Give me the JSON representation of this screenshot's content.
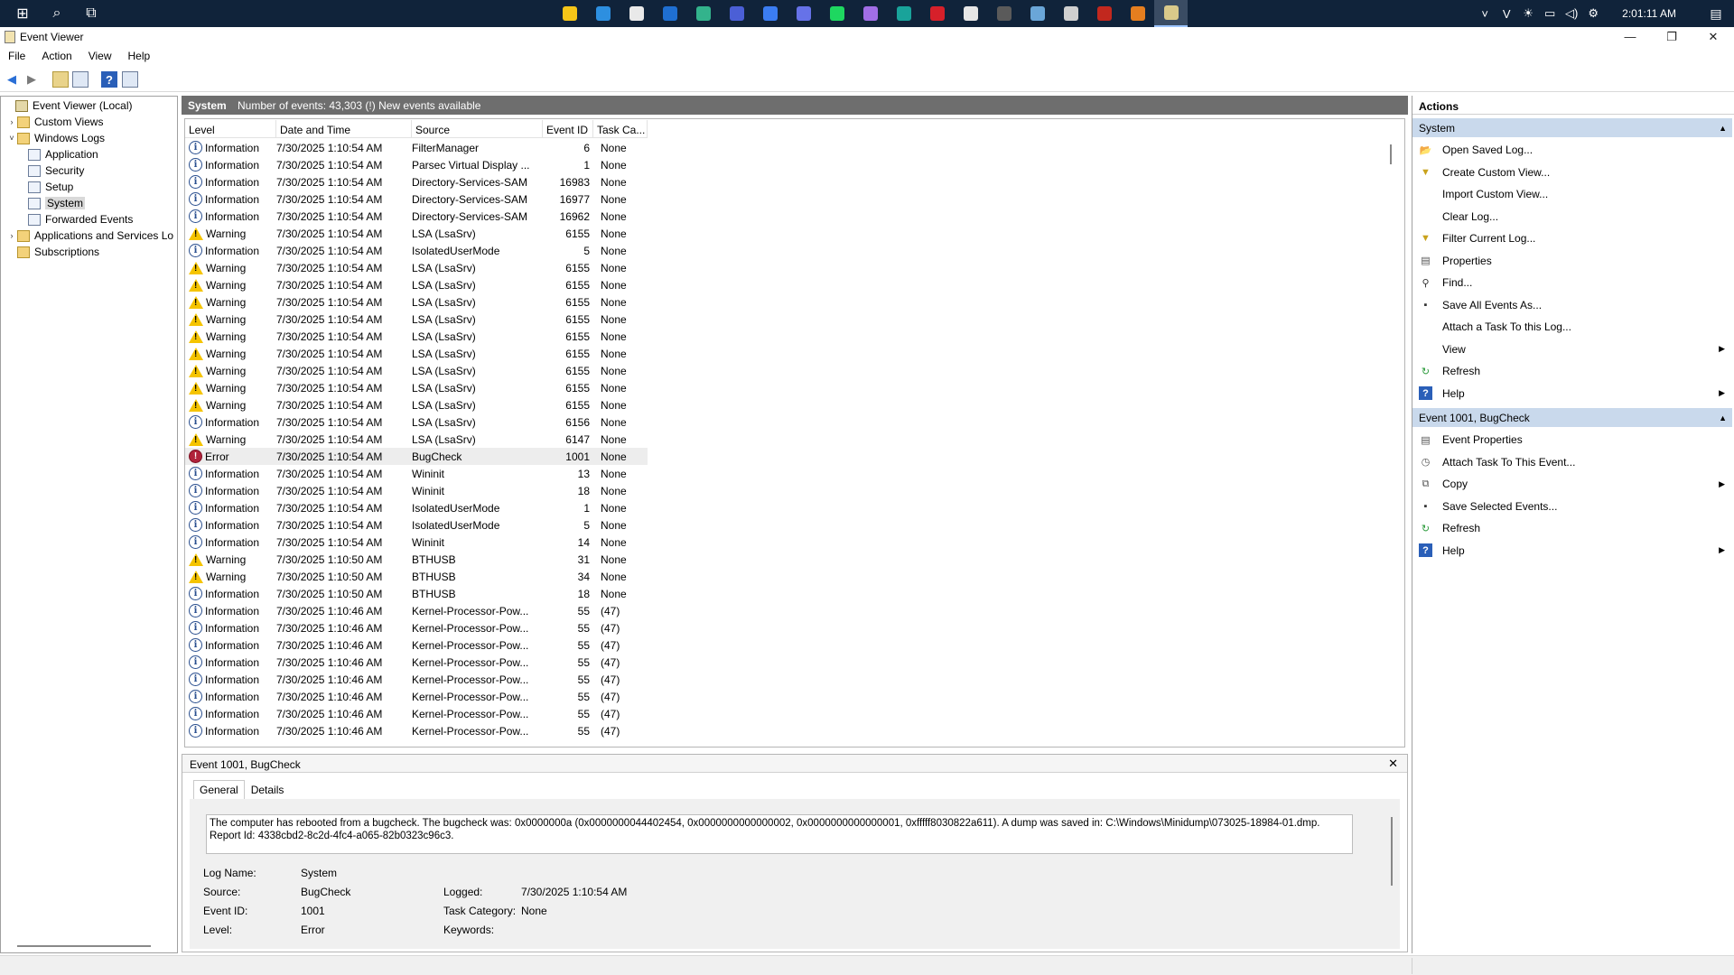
{
  "taskbar": {
    "apps": [
      {
        "name": "file-explorer-icon",
        "color": "#f5c518"
      },
      {
        "name": "vscode-icon",
        "color": "#2d8fe0"
      },
      {
        "name": "store-icon",
        "color": "#e9e9e9"
      },
      {
        "name": "remote-desktop-icon",
        "color": "#1f6fd1"
      },
      {
        "name": "edge-icon",
        "color": "#33b38c"
      },
      {
        "name": "teams-icon",
        "color": "#4b5fd6"
      },
      {
        "name": "messenger-icon",
        "color": "#3b7df2"
      },
      {
        "name": "discord-icon",
        "color": "#6672e8"
      },
      {
        "name": "spotify-icon",
        "color": "#1ed760"
      },
      {
        "name": "github-icon",
        "color": "#a16ee6"
      },
      {
        "name": "arduino-icon",
        "color": "#19a39a"
      },
      {
        "name": "amd-icon",
        "color": "#d6202a"
      },
      {
        "name": "media-icon",
        "color": "#e6e6e6"
      },
      {
        "name": "obs-icon",
        "color": "#5a5a5a"
      },
      {
        "name": "remote-icon",
        "color": "#6aa6d8"
      },
      {
        "name": "unreal-icon",
        "color": "#cfcfcf"
      },
      {
        "name": "acrobat-icon",
        "color": "#c2281e"
      },
      {
        "name": "matlab-icon",
        "color": "#e57e1f"
      },
      {
        "name": "event-viewer-icon",
        "color": "#d9c98a"
      }
    ],
    "clock": "2:01:11 AM"
  },
  "window": {
    "title": "Event Viewer",
    "minimize": "—",
    "maximize": "❐",
    "close": "✕"
  },
  "menu": [
    "File",
    "Action",
    "View",
    "Help"
  ],
  "tree": {
    "root": "Event Viewer (Local)",
    "custom_views": "Custom Views",
    "windows_logs": "Windows Logs",
    "application": "Application",
    "security": "Security",
    "setup": "Setup",
    "system": "System",
    "forwarded": "Forwarded Events",
    "apps_services": "Applications and Services Lo",
    "subscriptions": "Subscriptions"
  },
  "center": {
    "title": "System",
    "info": "Number of events: 43,303 (!) New events available"
  },
  "columns": {
    "level": "Level",
    "date": "Date and Time",
    "source": "Source",
    "event_id": "Event ID",
    "task": "Task Ca..."
  },
  "events": [
    {
      "level": "Information",
      "date": "7/30/2025 1:10:54 AM",
      "source": "FilterManager",
      "id": "6",
      "task": "None"
    },
    {
      "level": "Information",
      "date": "7/30/2025 1:10:54 AM",
      "source": "Parsec Virtual Display ...",
      "id": "1",
      "task": "None"
    },
    {
      "level": "Information",
      "date": "7/30/2025 1:10:54 AM",
      "source": "Directory-Services-SAM",
      "id": "16983",
      "task": "None"
    },
    {
      "level": "Information",
      "date": "7/30/2025 1:10:54 AM",
      "source": "Directory-Services-SAM",
      "id": "16977",
      "task": "None"
    },
    {
      "level": "Information",
      "date": "7/30/2025 1:10:54 AM",
      "source": "Directory-Services-SAM",
      "id": "16962",
      "task": "None"
    },
    {
      "level": "Warning",
      "date": "7/30/2025 1:10:54 AM",
      "source": "LSA (LsaSrv)",
      "id": "6155",
      "task": "None"
    },
    {
      "level": "Information",
      "date": "7/30/2025 1:10:54 AM",
      "source": "IsolatedUserMode",
      "id": "5",
      "task": "None"
    },
    {
      "level": "Warning",
      "date": "7/30/2025 1:10:54 AM",
      "source": "LSA (LsaSrv)",
      "id": "6155",
      "task": "None"
    },
    {
      "level": "Warning",
      "date": "7/30/2025 1:10:54 AM",
      "source": "LSA (LsaSrv)",
      "id": "6155",
      "task": "None"
    },
    {
      "level": "Warning",
      "date": "7/30/2025 1:10:54 AM",
      "source": "LSA (LsaSrv)",
      "id": "6155",
      "task": "None"
    },
    {
      "level": "Warning",
      "date": "7/30/2025 1:10:54 AM",
      "source": "LSA (LsaSrv)",
      "id": "6155",
      "task": "None"
    },
    {
      "level": "Warning",
      "date": "7/30/2025 1:10:54 AM",
      "source": "LSA (LsaSrv)",
      "id": "6155",
      "task": "None"
    },
    {
      "level": "Warning",
      "date": "7/30/2025 1:10:54 AM",
      "source": "LSA (LsaSrv)",
      "id": "6155",
      "task": "None"
    },
    {
      "level": "Warning",
      "date": "7/30/2025 1:10:54 AM",
      "source": "LSA (LsaSrv)",
      "id": "6155",
      "task": "None"
    },
    {
      "level": "Warning",
      "date": "7/30/2025 1:10:54 AM",
      "source": "LSA (LsaSrv)",
      "id": "6155",
      "task": "None"
    },
    {
      "level": "Warning",
      "date": "7/30/2025 1:10:54 AM",
      "source": "LSA (LsaSrv)",
      "id": "6155",
      "task": "None"
    },
    {
      "level": "Information",
      "date": "7/30/2025 1:10:54 AM",
      "source": "LSA (LsaSrv)",
      "id": "6156",
      "task": "None"
    },
    {
      "level": "Warning",
      "date": "7/30/2025 1:10:54 AM",
      "source": "LSA (LsaSrv)",
      "id": "6147",
      "task": "None"
    },
    {
      "level": "Error",
      "date": "7/30/2025 1:10:54 AM",
      "source": "BugCheck",
      "id": "1001",
      "task": "None"
    },
    {
      "level": "Information",
      "date": "7/30/2025 1:10:54 AM",
      "source": "Wininit",
      "id": "13",
      "task": "None"
    },
    {
      "level": "Information",
      "date": "7/30/2025 1:10:54 AM",
      "source": "Wininit",
      "id": "18",
      "task": "None"
    },
    {
      "level": "Information",
      "date": "7/30/2025 1:10:54 AM",
      "source": "IsolatedUserMode",
      "id": "1",
      "task": "None"
    },
    {
      "level": "Information",
      "date": "7/30/2025 1:10:54 AM",
      "source": "IsolatedUserMode",
      "id": "5",
      "task": "None"
    },
    {
      "level": "Information",
      "date": "7/30/2025 1:10:54 AM",
      "source": "Wininit",
      "id": "14",
      "task": "None"
    },
    {
      "level": "Warning",
      "date": "7/30/2025 1:10:50 AM",
      "source": "BTHUSB",
      "id": "31",
      "task": "None"
    },
    {
      "level": "Warning",
      "date": "7/30/2025 1:10:50 AM",
      "source": "BTHUSB",
      "id": "34",
      "task": "None"
    },
    {
      "level": "Information",
      "date": "7/30/2025 1:10:50 AM",
      "source": "BTHUSB",
      "id": "18",
      "task": "None"
    },
    {
      "level": "Information",
      "date": "7/30/2025 1:10:46 AM",
      "source": "Kernel-Processor-Pow...",
      "id": "55",
      "task": "(47)"
    },
    {
      "level": "Information",
      "date": "7/30/2025 1:10:46 AM",
      "source": "Kernel-Processor-Pow...",
      "id": "55",
      "task": "(47)"
    },
    {
      "level": "Information",
      "date": "7/30/2025 1:10:46 AM",
      "source": "Kernel-Processor-Pow...",
      "id": "55",
      "task": "(47)"
    },
    {
      "level": "Information",
      "date": "7/30/2025 1:10:46 AM",
      "source": "Kernel-Processor-Pow...",
      "id": "55",
      "task": "(47)"
    },
    {
      "level": "Information",
      "date": "7/30/2025 1:10:46 AM",
      "source": "Kernel-Processor-Pow...",
      "id": "55",
      "task": "(47)"
    },
    {
      "level": "Information",
      "date": "7/30/2025 1:10:46 AM",
      "source": "Kernel-Processor-Pow...",
      "id": "55",
      "task": "(47)"
    },
    {
      "level": "Information",
      "date": "7/30/2025 1:10:46 AM",
      "source": "Kernel-Processor-Pow...",
      "id": "55",
      "task": "(47)"
    },
    {
      "level": "Information",
      "date": "7/30/2025 1:10:46 AM",
      "source": "Kernel-Processor-Pow...",
      "id": "55",
      "task": "(47)"
    }
  ],
  "selected_event_index": 18,
  "detail": {
    "title": "Event 1001, BugCheck",
    "close": "✕",
    "tab_general": "General",
    "tab_details": "Details",
    "message_line1": "The computer has rebooted from a bugcheck.  The bugcheck was: 0x0000000a (0x0000000044402454, 0x0000000000000002, 0x0000000000000001, 0xfffff8030822a611). A dump was saved in: C:\\Windows\\Minidump\\073025-18984-01.dmp.",
    "message_line2": "Report Id: 4338cbd2-8c2d-4fc4-a065-82b0323c96c3.",
    "log_name_label": "Log Name:",
    "log_name": "System",
    "source_label": "Source:",
    "source": "BugCheck",
    "logged_label": "Logged:",
    "logged": "7/30/2025 1:10:54 AM",
    "event_id_label": "Event ID:",
    "event_id": "1001",
    "task_category_label": "Task Category:",
    "task_category": "None",
    "level_label": "Level:",
    "level": "Error",
    "keywords_label": "Keywords:"
  },
  "actions": {
    "title": "Actions",
    "section_system": "System",
    "system_items": [
      {
        "label": "Open Saved Log...",
        "icon": "open-log-icon",
        "submenu": false
      },
      {
        "label": "Create Custom View...",
        "icon": "filter-icon",
        "submenu": false
      },
      {
        "label": "Import Custom View...",
        "icon": "",
        "submenu": false
      },
      {
        "label": "Clear Log...",
        "icon": "",
        "submenu": false
      },
      {
        "label": "Filter Current Log...",
        "icon": "filter-icon",
        "submenu": false
      },
      {
        "label": "Properties",
        "icon": "properties-icon",
        "submenu": false
      },
      {
        "label": "Find...",
        "icon": "find-icon",
        "submenu": false
      },
      {
        "label": "Save All Events As...",
        "icon": "save-icon",
        "submenu": false
      },
      {
        "label": "Attach a Task To this Log...",
        "icon": "",
        "submenu": false
      },
      {
        "label": "View",
        "icon": "",
        "submenu": true
      },
      {
        "label": "Refresh",
        "icon": "refresh-icon",
        "submenu": false
      },
      {
        "label": "Help",
        "icon": "help-icon",
        "submenu": true
      }
    ],
    "section_event": "Event 1001, BugCheck",
    "event_items": [
      {
        "label": "Event Properties",
        "icon": "properties-icon",
        "submenu": false
      },
      {
        "label": "Attach Task To This Event...",
        "icon": "task-icon",
        "submenu": false
      },
      {
        "label": "Copy",
        "icon": "copy-icon",
        "submenu": true
      },
      {
        "label": "Save Selected Events...",
        "icon": "save-icon",
        "submenu": false
      },
      {
        "label": "Refresh",
        "icon": "refresh-icon",
        "submenu": false
      },
      {
        "label": "Help",
        "icon": "help-icon",
        "submenu": true
      }
    ]
  }
}
